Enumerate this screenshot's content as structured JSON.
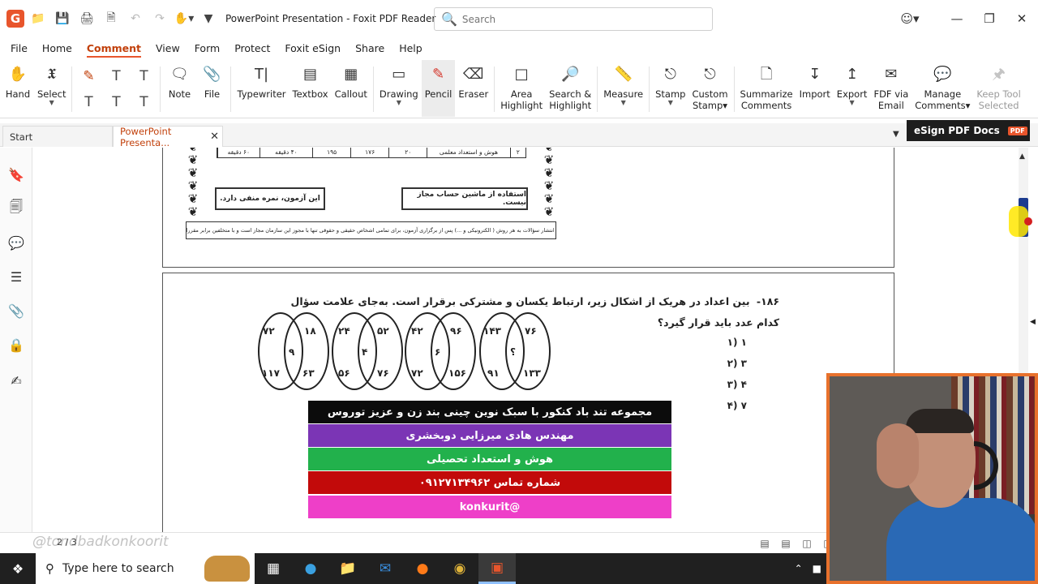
{
  "titlebar": {
    "title": "PowerPoint Presentation - Foxit PDF Reader",
    "search_placeholder": "Search",
    "app_logo": "G"
  },
  "menu": {
    "items": [
      "File",
      "Home",
      "Comment",
      "View",
      "Form",
      "Protect",
      "Foxit eSign",
      "Share",
      "Help"
    ],
    "active": "Comment"
  },
  "ribbon": {
    "hand": "Hand",
    "select": "Select",
    "note": "Note",
    "file": "File",
    "typewriter": "Typewriter",
    "textbox": "Textbox",
    "callout": "Callout",
    "drawing": "Drawing",
    "pencil": "Pencil",
    "eraser": "Eraser",
    "area_highlight": [
      "Area",
      "Highlight"
    ],
    "search_highlight": [
      "Search &",
      "Highlight"
    ],
    "measure": "Measure",
    "stamp": "Stamp",
    "custom_stamp": [
      "Custom",
      "Stamp"
    ],
    "summarize": [
      "Summarize",
      "Comments"
    ],
    "import": "Import",
    "export": "Export",
    "fdf_email": [
      "FDF via",
      "Email"
    ],
    "manage": [
      "Manage",
      "Comments"
    ],
    "keep_tool": [
      "Keep Tool",
      "Selected"
    ]
  },
  "tabs": {
    "start": "Start",
    "doc": "PowerPoint Presenta..."
  },
  "esign": {
    "label": "eSign PDF Docs",
    "badge": "PDF"
  },
  "page1": {
    "table_cells": [
      "۲",
      "هوش و استعداد معلمی",
      "۲۰",
      "۱۷۶",
      "۱۹۵",
      "۴۰ دقیقه",
      "۶۰ دقیقه"
    ],
    "note_right": "استفاده از ماشین حساب مجاز نیست.",
    "note_left": "این آزمون، نمره منفی دارد.",
    "footer": "حق چاپ، تکثیر و انتشار سؤالات به هر روش ( الکترونیکی و ...) پس از برگزاری آزمون، برای تمامی اشخاص حقیقی و حقوقی تنها با مجوز این سازمان مجاز است و با متخلفین برابر مقررات رفتار می‌شود."
  },
  "question": {
    "number": "۱۸۶-",
    "text": "بین اعداد در هریک از اشکال زیر، ارتباط یکسان و مشترکی برقرار است. به‌جای علامت سؤال کدام عدد باید قرار گیرد؟",
    "options": [
      "۱ (۱",
      "۳ (۲",
      "۴ (۳",
      "۷ (۴"
    ],
    "venns": [
      {
        "tl": "۷۲",
        "tr": "۱۸",
        "c": "۹",
        "bl": "۱۱۷",
        "br": "۶۳"
      },
      {
        "tl": "۲۴",
        "tr": "۵۲",
        "c": "۴",
        "bl": "۵۶",
        "br": "۷۶"
      },
      {
        "tl": "۴۲",
        "tr": "۹۶",
        "c": "۶",
        "bl": "۷۲",
        "br": "۱۵۶"
      },
      {
        "tl": "۱۴۳",
        "tr": "۷۶",
        "c": "؟",
        "bl": "۹۱",
        "br": "۱۳۳"
      }
    ]
  },
  "banners": [
    {
      "text": "مجموعه تند باد کنکور با سبک نوین چینی بند زن و عزیز توروس",
      "color": "#0c0c0c"
    },
    {
      "text": "مهندس هادی میرزایی دوبخشری",
      "color": "#7b35b5"
    },
    {
      "text": "هوش و استعداد تحصیلی",
      "color": "#22b14c"
    },
    {
      "text": "شماره تماس ۰۹۱۲۷۱۳۴۹۶۲",
      "color": "#c20a0a"
    },
    {
      "text": "@konkurit",
      "color": "#ee3fc8"
    }
  ],
  "status": {
    "page": "2 / 3",
    "watermark": "@tondbadkonkoorit"
  },
  "taskbar": {
    "search_placeholder": "Type here to search"
  }
}
